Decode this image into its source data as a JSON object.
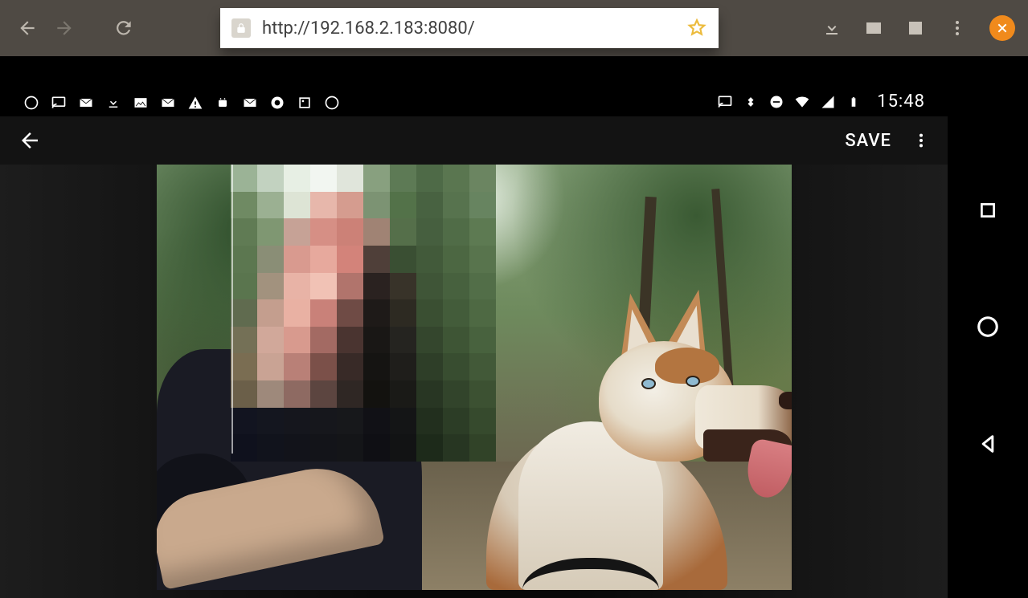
{
  "browser": {
    "url": "http://192.168.2.183:8080/"
  },
  "status_bar": {
    "clock": "15:48",
    "left_icons": [
      "bubble",
      "cast",
      "mail",
      "download",
      "image",
      "mail2",
      "warning",
      "android",
      "mail3",
      "voicemail",
      "square",
      "bubble2"
    ],
    "right_icons": [
      "cast",
      "bluetooth",
      "dnd",
      "wifi",
      "signal",
      "battery"
    ]
  },
  "app_bar": {
    "save_label": "SAVE"
  },
  "mosaic_colors": [
    "#9bb396",
    "#c2d2c0",
    "#e7efe4",
    "#f2f6f1",
    "#e0e5db",
    "#88a07f",
    "#5d7a55",
    "#4e6a47",
    "#5a7650",
    "#6b8561",
    "#6f8a63",
    "#9bb092",
    "#dde4d5",
    "#e7b7ab",
    "#d59c8f",
    "#7c9373",
    "#537249",
    "#486241",
    "#57734e",
    "#678460",
    "#607b54",
    "#7f9772",
    "#c6a296",
    "#d68f85",
    "#cc8177",
    "#a08374",
    "#556f4a",
    "#465f3f",
    "#506c47",
    "#5d7a52",
    "#5c7750",
    "#8a8e76",
    "#d99a8f",
    "#e7a99d",
    "#d3837a",
    "#4f3f39",
    "#3a4f33",
    "#425a3a",
    "#4c6742",
    "#58744d",
    "#5a754e",
    "#a2927e",
    "#e8b3a6",
    "#f1c2b5",
    "#b1746c",
    "#2a2220",
    "#383329",
    "#3f5537",
    "#47613e",
    "#526e48",
    "#606b4f",
    "#c49e8e",
    "#e9b1a3",
    "#c98179",
    "#6f4b45",
    "#1e1a18",
    "#2d2a22",
    "#3a4f32",
    "#435c3a",
    "#4e6943",
    "#747056",
    "#d1a89a",
    "#d89a8e",
    "#a36a63",
    "#4a3430",
    "#191715",
    "#252420",
    "#34462d",
    "#3e5535",
    "#48623e",
    "#7a6d52",
    "#c9a394",
    "#b98077",
    "#7b5049",
    "#382a27",
    "#151412",
    "#1f1e1b",
    "#2e3e28",
    "#384d30",
    "#425938",
    "#6b5f49",
    "#9e897b",
    "#8e6a62",
    "#5c4540",
    "#2f2724",
    "#13120f",
    "#1a1a17",
    "#283623",
    "#32442b",
    "#3c5132",
    "#121420",
    "#14161f",
    "#15161d",
    "#16171c",
    "#17181b",
    "#111116",
    "#141516",
    "#222f1e",
    "#2c3d26",
    "#364a2d",
    "#0f111d",
    "#11131c",
    "#12131a",
    "#131419",
    "#141518",
    "#0f0f14",
    "#121314",
    "#1d2a1a",
    "#273622",
    "#314328"
  ]
}
